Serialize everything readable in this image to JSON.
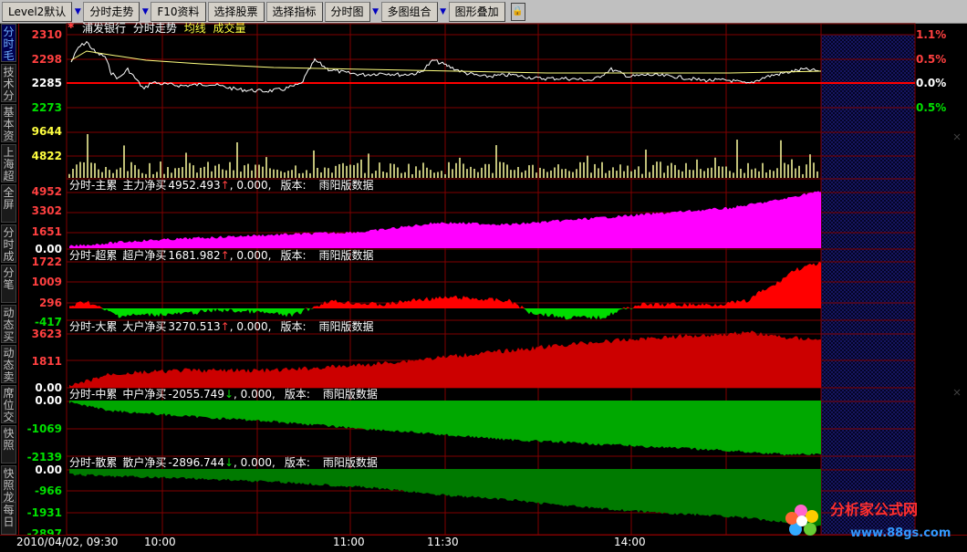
{
  "toolbar": {
    "items": [
      "Level2默认",
      "分时走势",
      "F10资料",
      "选择股票",
      "选择指标",
      "分时图",
      "多图组合",
      "图形叠加"
    ],
    "arrow_glyph": "▼",
    "lock_glyph": "🔒"
  },
  "sidebar": {
    "tabs": [
      "分时毛",
      "技术分",
      "基本资",
      "上海超",
      "全屏",
      "分时成",
      "分笔",
      "动态买",
      "动态卖",
      "席位交",
      "快照",
      "快照龙",
      "每日"
    ]
  },
  "main_chart": {
    "header": [
      "浦发银行",
      "分时走势",
      "均线",
      "成交量"
    ],
    "price_labels": [
      "2310",
      "2298",
      "2285",
      "2273"
    ],
    "pct_labels": [
      "1.1%",
      "0.5%",
      "0.0%",
      "0.5%"
    ],
    "volume_labels": [
      "9644",
      "4822"
    ]
  },
  "panels": [
    {
      "title": "分时-主累",
      "name": "主力净买",
      "value": "4952.493",
      "arrow": "↑",
      "extra": ", 0.000,",
      "ver_label": "版本:",
      "ver": "雨阳版数据",
      "y_labels": [
        "4952",
        "3302",
        "1651",
        "0.00"
      ]
    },
    {
      "title": "分时-超累",
      "name": "超户净买",
      "value": "1681.982",
      "arrow": "↑",
      "extra": ", 0.000,",
      "ver_label": "版本:",
      "ver": "雨阳版数据",
      "y_labels": [
        "1722",
        "1009",
        "296",
        "-417"
      ]
    },
    {
      "title": "分时-大累",
      "name": "大户净买",
      "value": "3270.513",
      "arrow": "↑",
      "extra": ", 0.000,",
      "ver_label": "版本:",
      "ver": "雨阳版数据",
      "y_labels": [
        "3623",
        "1811",
        "0.00"
      ]
    },
    {
      "title": "分时-中累",
      "name": "中户净买",
      "value": "-2055.749",
      "arrow": "↓",
      "extra": ", 0.000,",
      "ver_label": "版本:",
      "ver": "雨阳版数据",
      "y_labels": [
        "0.00",
        "-1069",
        "-2139"
      ]
    },
    {
      "title": "分时-散累",
      "name": "散户净买",
      "value": "-2896.744",
      "arrow": "↓",
      "extra": ", 0.000,",
      "ver_label": "版本:",
      "ver": "雨阳版数据",
      "y_labels": [
        "0.00",
        "-966",
        "-1931",
        "-2897"
      ]
    }
  ],
  "time_axis": {
    "cursor_label": "2010/04/02, 09:30",
    "ticks": [
      "10:00",
      "11:00",
      "11:30",
      "14:00"
    ]
  },
  "logo": {
    "text": "分析家公式网",
    "url": "www.88gs.com"
  },
  "colors": {
    "grid": "#800000",
    "pink": "#ff00ff",
    "red": "#ff0000",
    "dark_red": "#cc0000",
    "green": "#00dd00",
    "dark_green": "#007a00",
    "price_line": "#ffffff",
    "avg_line": "#ffff80",
    "volume": "#ffffa0",
    "label_red": "#ff4040",
    "label_green": "#00e000",
    "label_yellow": "#ffff40"
  }
}
